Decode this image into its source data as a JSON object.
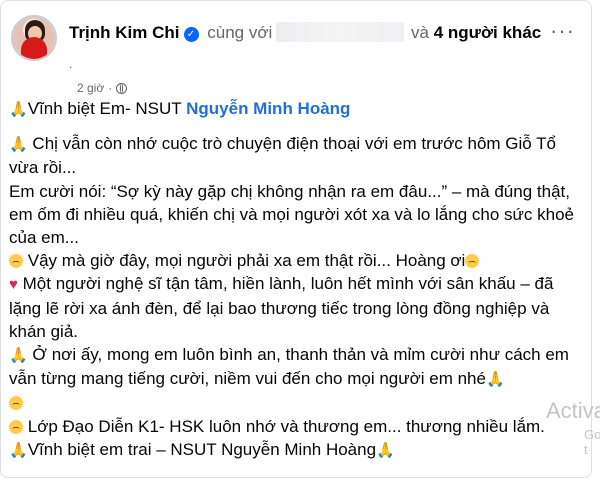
{
  "post": {
    "author": "Trịnh Kim Chi",
    "with_prefix": "cùng với",
    "others_prefix": "và",
    "others": "4 người khác",
    "dot_line": ".",
    "time": "2 giờ",
    "meta_sep": "·",
    "more_icon": "···",
    "verified_icon": "✓",
    "line1_text": "Vĩnh biệt Em- NSUT",
    "line1_name": "Nguyễn Minh Hoàng",
    "para1": "Chị vẫn còn nhớ cuộc trò chuyện điện thoại với em trước hôm Giỗ Tổ vừa rồi...",
    "para2": "Em cười nói: “Sợ kỳ này gặp chị không nhận ra em đâu...” – mà đúng thật, em ốm đi nhiều quá, khiến chị và mọi người xót xa và lo lắng cho sức khoẻ của em...",
    "para3a": "Vậy mà giờ đây, mọi người phải xa em thật rồi... Hoàng ơi",
    "para4": "Một người nghệ sĩ tận tâm, hiền lành, luôn hết mình với sân khấu – đã lặng lẽ rời xa ánh đèn, để lại bao thương tiếc trong lòng đồng nghiệp và khán giả.",
    "para5": "Ở nơi ấy, mong em luôn bình an, thanh thản và mỉm cười như cách em vẫn từng mang tiếng cười, niềm vui đến cho mọi người em nhé",
    "para6": "Lớp Đạo Diễn K1- HSK luôn nhớ và thương em... thương nhiều lắm.",
    "para7": "Vĩnh biệt em trai – NSUT Nguyễn Minh Hoàng",
    "pray_icon": "🙏",
    "heart_icon": "♥"
  },
  "watermark": {
    "line1": "Activa",
    "line2": "Go t"
  },
  "colors": {
    "link": "#216fdb",
    "verified": "#0866ff",
    "secondary_text": "#65676b"
  }
}
